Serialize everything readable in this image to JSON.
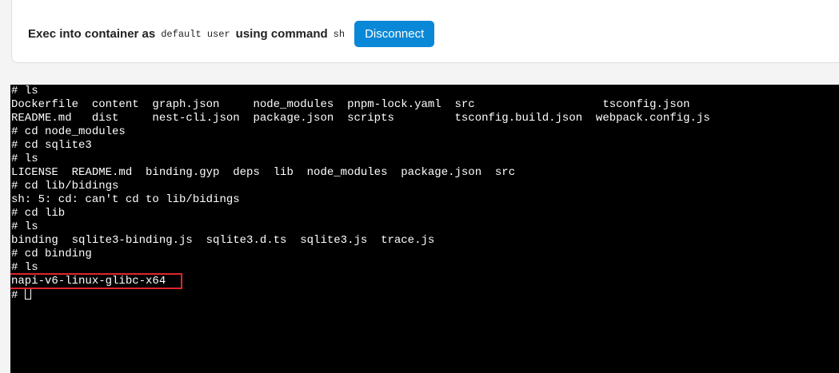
{
  "exec_bar": {
    "prefix": "Exec into container as",
    "user": "default user",
    "middle": "using command",
    "command": "sh",
    "disconnect_label": "Disconnect"
  },
  "terminal": {
    "lines": [
      "# ls",
      "Dockerfile  content  graph.json     node_modules  pnpm-lock.yaml  src                   tsconfig.json",
      "README.md   dist     nest-cli.json  package.json  scripts         tsconfig.build.json  webpack.config.js",
      "# cd node_modules",
      "# cd sqlite3",
      "# ls",
      "LICENSE  README.md  binding.gyp  deps  lib  node_modules  package.json  src",
      "# cd lib/bidings",
      "sh: 5: cd: can't cd to lib/bidings",
      "# cd lib",
      "# ls",
      "binding  sqlite3-binding.js  sqlite3.d.ts  sqlite3.js  trace.js",
      "# cd binding",
      "# ls",
      "napi-v6-linux-glibc-x64",
      "# "
    ]
  },
  "colors": {
    "accent": "#0a88d8",
    "highlight": "#e0252b",
    "terminal_bg": "#000000",
    "terminal_fg": "#ffffff"
  }
}
